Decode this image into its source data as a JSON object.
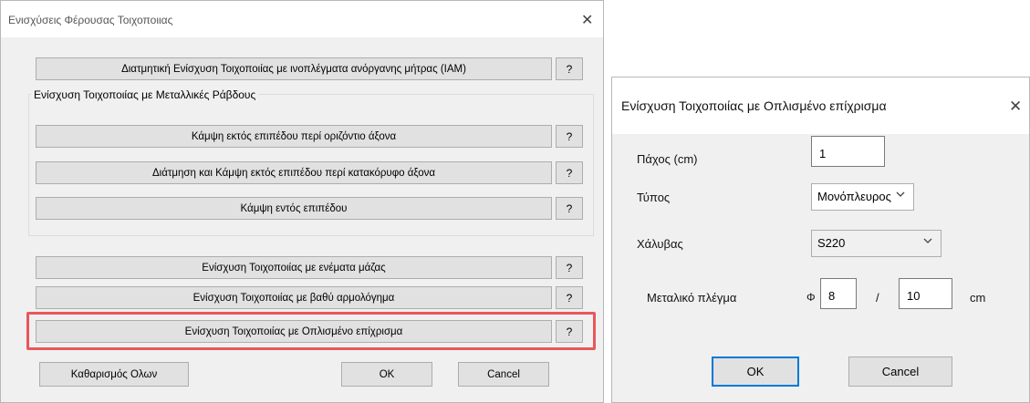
{
  "dialog1": {
    "title": "Ενισχύσεις Φέρουσας Τοιχοποιιας",
    "close_glyph": "✕",
    "btn_iam": "Διατμητική Ενίσχυση Τοιχοποιίας με ινοπλέγματα ανόργανης μήτρας (IAM)",
    "group_title": "Ενίσχυση Τοιχοποιίας με Μεταλλικές Ράβδους",
    "btn_bend_horiz": "Κάμψη εκτός επιπέδου περί οριζόντιο άξονα",
    "btn_shear_bend_vert": "Διάτμηση και Κάμψη εκτός επιπέδου περί κατακόρυφο άξονα",
    "btn_bend_in_plane": "Κάμψη εντός επιπέδου",
    "btn_injections": "Ενίσχυση Τοιχοποιίας με ενέματα μάζας",
    "btn_deep_joint": "Ενίσχυση Τοιχοποιίας με βαθύ αρμολόγημα",
    "btn_plaster": "Ενίσχυση Τοιχοποιίας με Οπλισμένο επίχρισμα",
    "help_label": "?",
    "btn_clear_all": "Καθαρισμός Ολων",
    "btn_ok": "OK",
    "btn_cancel": "Cancel"
  },
  "dialog2": {
    "title": "Ενίσχυση Τοιχοποιίας με Οπλισμένο επίχρισμα",
    "close_glyph": "✕",
    "thickness_label": "Πάχος (cm)",
    "thickness_value": "1",
    "type_label": "Τύπος",
    "type_value": "Μονόπλευρος",
    "steel_label": "Χάλυβας",
    "steel_value": "S220",
    "mesh_label": "Μεταλικό πλέγμα",
    "phi_symbol": "Φ",
    "mesh_diameter": "8",
    "slash": "/",
    "mesh_spacing": "10",
    "unit_cm": "cm",
    "btn_ok": "OK",
    "btn_cancel": "Cancel"
  },
  "colors": {
    "highlight": "#e8575a",
    "dialog_bg": "#f0f0f0",
    "button_bg": "#e1e1e1",
    "focus": "#0078d7"
  }
}
